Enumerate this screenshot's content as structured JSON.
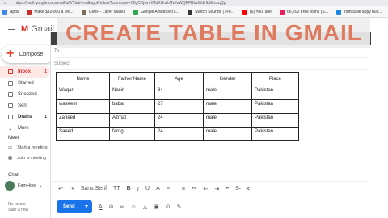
{
  "browser": {
    "url": "https://mail.google.com/mail/u/0/?tab=rm&ogbl#inbox?compose=CllgCKjwnHMdKHnrhfTwfsWQPFBbvWdHbWmxqQp",
    "bookmarks": [
      {
        "label": "Apps",
        "color": "#4285f4"
      },
      {
        "label": "Make $10,000 a Mo...",
        "color": "#c4302b"
      },
      {
        "label": "GIMP - Layer Masks",
        "color": "#7a6c5d"
      },
      {
        "label": "Google Advanced L...",
        "color": "#34a853"
      },
      {
        "label": "Switch Sounds | Fre...",
        "color": "#333333"
      },
      {
        "label": "(6) YouTube",
        "color": "#ff0000"
      },
      {
        "label": "66,200 Free Icons (S...",
        "color": "#e91e63"
      },
      {
        "label": "thunkable appy buil...",
        "color": "#1e88e5"
      }
    ]
  },
  "gmail": {
    "logo": "Gmail",
    "compose": "Compose",
    "nav": [
      {
        "label": "Inbox",
        "count": "1"
      },
      {
        "label": "Starred",
        "count": ""
      },
      {
        "label": "Snoozed",
        "count": ""
      },
      {
        "label": "Sent",
        "count": ""
      },
      {
        "label": "Drafts",
        "count": "1"
      },
      {
        "label": "More",
        "count": ""
      }
    ],
    "meet": {
      "title": "Meet",
      "start": "Start a meeting",
      "join": "Join a meeting"
    },
    "chat": {
      "title": "Chat",
      "user": "FamHow",
      "no_recent": [
        "No recent",
        "Start a new"
      ]
    }
  },
  "banner": {
    "title": "CREATE TABLE IN GMAIL"
  },
  "compose_window": {
    "to_label": "To",
    "subject_placeholder": "Subject"
  },
  "table": {
    "headers": [
      "Name",
      "Father Name",
      "Age",
      "Gender",
      "Place"
    ],
    "rows": [
      [
        "Waqar",
        "Nasir",
        "34",
        "male",
        "Pakistan"
      ],
      [
        "waseem",
        "babar",
        "27",
        "male",
        "Pakistan"
      ],
      [
        "Zaheed",
        "Azmat",
        "24",
        "male",
        "Pakistan"
      ],
      [
        "Saeed",
        "farog",
        "24",
        "male",
        "Pakistan"
      ]
    ]
  },
  "toolbar": {
    "undo": "↶",
    "redo": "↷",
    "font": "Sans Serif",
    "size": "TT",
    "bold": "B",
    "italic": "I",
    "underline": "U",
    "color": "A",
    "align": "≡",
    "numbered": "⋮≡",
    "bulleted": "•≡",
    "indent_less": "⇤",
    "indent_more": "⇥",
    "quote": "❝",
    "strike": "S̶",
    "clear": "✕"
  },
  "bottom": {
    "send": "Send",
    "format": "A",
    "attach": "⊘",
    "link": "∞",
    "emoji": "☺",
    "drive": "△",
    "photo": "▣",
    "lock": "⊙",
    "sign": "✎"
  }
}
